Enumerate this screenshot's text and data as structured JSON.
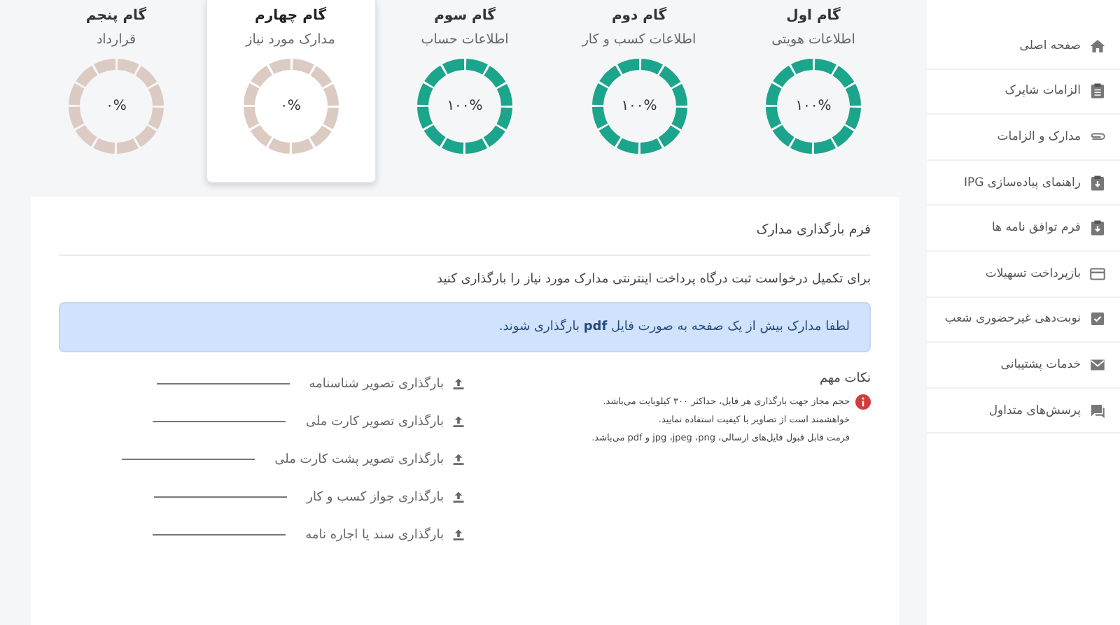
{
  "steps": [
    {
      "title": "گام اول",
      "subtitle": "اطلاعات هویتی",
      "level": 1,
      "percent": "۱۰۰%",
      "selected": false
    },
    {
      "title": "گام دوم",
      "subtitle": "اطلاعات کسب و کار",
      "level": 1,
      "percent": "۱۰۰%",
      "selected": false
    },
    {
      "title": "گام سوم",
      "subtitle": "اطلاعات حساب",
      "level": 1,
      "percent": "۱۰۰%",
      "selected": false
    },
    {
      "title": "گام چهارم",
      "subtitle": "مدارک مورد نیاز",
      "level": 0,
      "percent": "۰%",
      "selected": true
    },
    {
      "title": "گام پنجم",
      "subtitle": "قرارداد",
      "level": 0,
      "percent": "۰%",
      "selected": false
    }
  ],
  "form": {
    "title": "فرم بارگذاری مدارک",
    "intro": "برای تکمیل درخواست ثبت درگاه پرداخت اینترنتی مدارک مورد نیاز را بارگذاری کنید",
    "alert": "لطفا مدارک بیش از یک صفحه به صورت فایل **pdf** بارگذاری شوند.",
    "notes": {
      "title": "نکات مهم",
      "lines": [
        "حجم مجاز جهت بارگذاری هر فایل، حداکثر ۳۰۰ کیلوبایت می‌باشد.",
        "خواهشمند است از تصاویر با کیفیت استفاده نمایید.",
        "فرمت قابل قبول فایل‌های ارسالی، jpg ،jpeg ،png و pdf می‌باشد."
      ]
    },
    "uploads": [
      "بارگذاری تصویر شناسنامه",
      "بارگذاری تصویر کارت ملی",
      "بارگذاری تصویر پشت کارت ملی",
      "بارگذاری جواز کسب و کار",
      "بارگذاری سند یا اجاره نامه"
    ]
  },
  "sidebar": {
    "items": [
      {
        "label": "صفحه اصلی"
      },
      {
        "label": "الزامات شاپرک"
      },
      {
        "label": "مدارک و الزامات"
      },
      {
        "label": "راهنمای پیاده‌سازی IPG"
      },
      {
        "label": "فرم توافق نامه ها"
      },
      {
        "label": "بازپرداخت تسهیلات"
      },
      {
        "label": "نوبت‌دهی غیرحضوری شعب"
      },
      {
        "label": "خدمات پشتیبانی"
      },
      {
        "label": "پرسش‌های متداول"
      }
    ]
  }
}
